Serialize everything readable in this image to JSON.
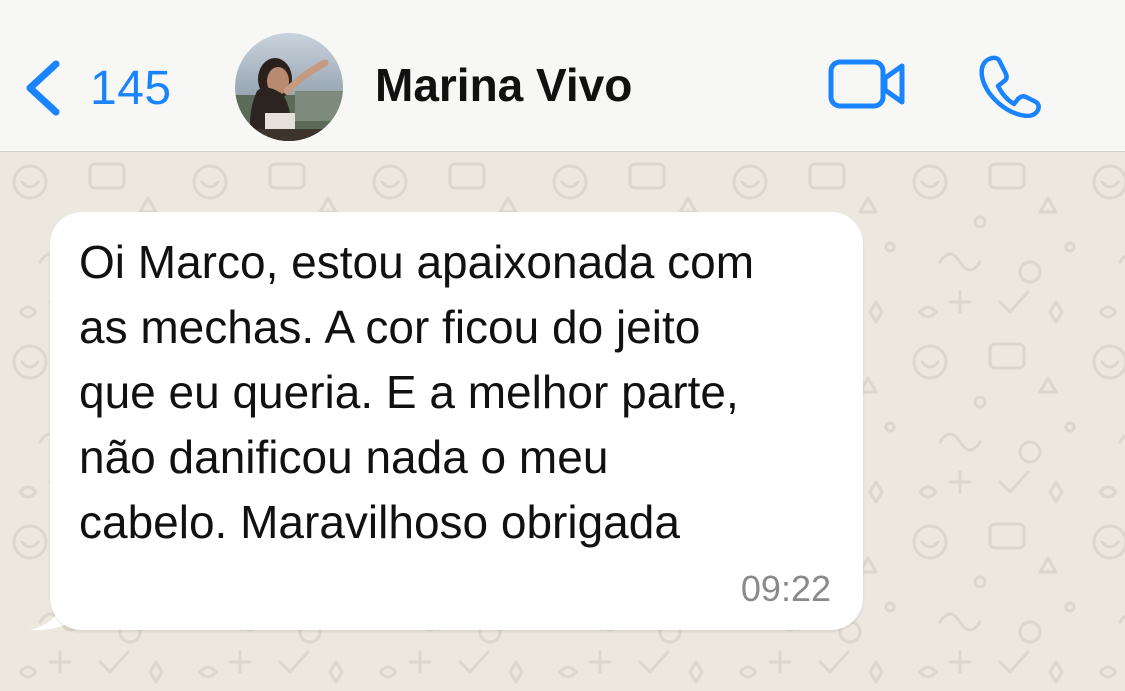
{
  "header": {
    "back_count": "145",
    "contact_name": "Marina Vivo",
    "back_icon": "chevron-left-icon",
    "video_icon": "video-camera-icon",
    "phone_icon": "phone-icon",
    "accent_color": "#1a84ff"
  },
  "message": {
    "lines": [
      "Oi Marco, estou apaixonada com",
      "as mechas. A cor ficou do jeito",
      "que eu queria. E a melhor parte,",
      "não danificou nada o meu",
      "cabelo. Maravilhoso obrigada"
    ],
    "time": "09:22",
    "direction": "incoming"
  }
}
